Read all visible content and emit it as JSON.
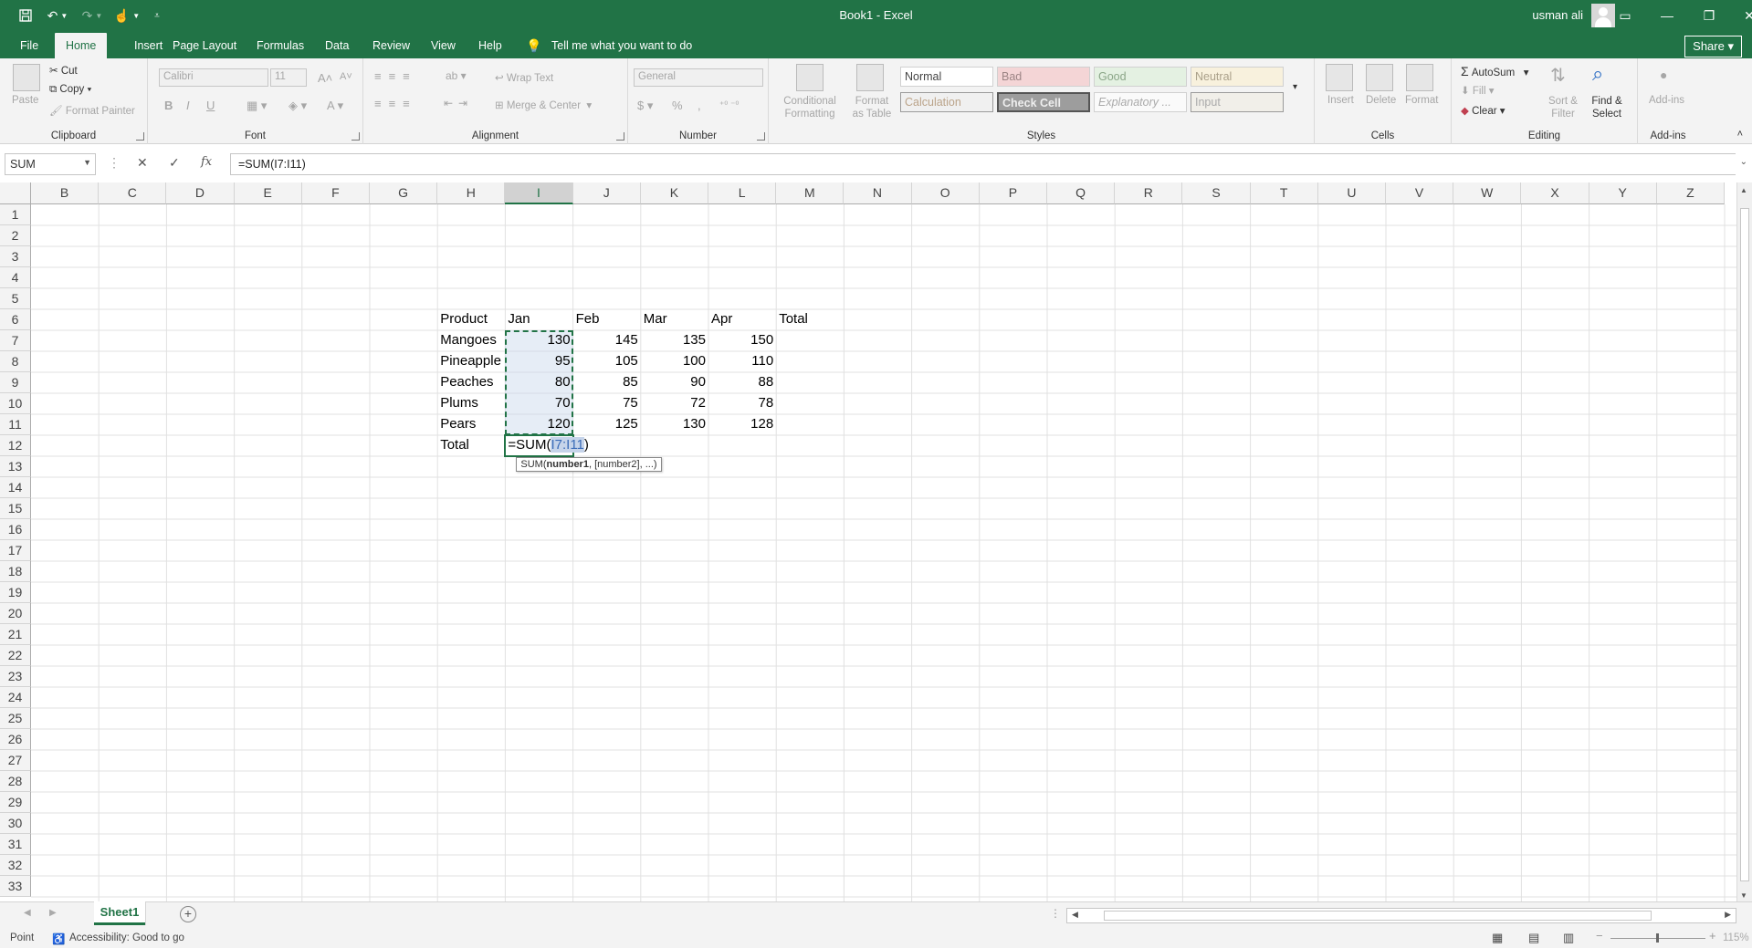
{
  "titlebar": {
    "title": "Book1  -  Excel",
    "user": "usman ali",
    "minimize": "—",
    "restore": "❐",
    "close": "✕",
    "ribbon_display": "▭"
  },
  "tabs": [
    "File",
    "Home",
    "Insert",
    "Page Layout",
    "Formulas",
    "Data",
    "Review",
    "View",
    "Help"
  ],
  "active_tab": "Home",
  "tell_me": "Tell me what you want to do",
  "share_label": "Share",
  "ribbon": {
    "clipboard": {
      "paste": "Paste",
      "cut": "Cut",
      "copy": "Copy",
      "format_painter": "Format Painter",
      "label": "Clipboard"
    },
    "font": {
      "font_name": "Calibri",
      "font_size": "11",
      "bold": "B",
      "italic": "I",
      "underline": "U",
      "label": "Font"
    },
    "alignment": {
      "wrap_text": "Wrap Text",
      "merge_center": "Merge & Center",
      "label": "Alignment"
    },
    "number": {
      "format": "General",
      "currency": "$",
      "percent": "%",
      "comma": ",",
      "label": "Number"
    },
    "styles": {
      "conditional_formatting": "Conditional Formatting",
      "format_as_table": "Format as Table",
      "cells": [
        "Normal",
        "Bad",
        "Good",
        "Neutral",
        "Calculation",
        "Check Cell",
        "Explanatory ...",
        "Input"
      ],
      "label": "Styles"
    },
    "cells": {
      "insert": "Insert",
      "delete": "Delete",
      "format": "Format",
      "label": "Cells"
    },
    "editing": {
      "autosum": "AutoSum",
      "fill": "Fill",
      "clear": "Clear",
      "sort_filter": "Sort & Filter",
      "find_select": "Find & Select",
      "label": "Editing"
    },
    "addins": {
      "addins": "Add-ins",
      "label": "Add-ins"
    }
  },
  "formula_bar": {
    "name_box": "SUM",
    "cancel": "✕",
    "enter": "✓",
    "fx": "fx",
    "formula": "=SUM(I7:I11)"
  },
  "columns": [
    "B",
    "C",
    "D",
    "E",
    "F",
    "G",
    "H",
    "I",
    "J",
    "K",
    "L",
    "M",
    "N",
    "O",
    "P",
    "Q",
    "R",
    "S",
    "T",
    "U",
    "V",
    "W",
    "X",
    "Y",
    "Z"
  ],
  "selected_column": "I",
  "rows": [
    "1",
    "2",
    "3",
    "4",
    "5",
    "6",
    "7",
    "8",
    "9",
    "10",
    "11",
    "12",
    "13",
    "14",
    "15",
    "16",
    "17",
    "18",
    "19",
    "20",
    "21",
    "22",
    "23",
    "24",
    "25",
    "26",
    "27",
    "28",
    "29",
    "30",
    "31",
    "32",
    "33"
  ],
  "table": {
    "headers": [
      "Product",
      "Jan",
      "Feb",
      "Mar",
      "Apr",
      "Total"
    ],
    "rows": [
      {
        "product": "Mangoes",
        "values": [
          "130",
          "145",
          "135",
          "150"
        ]
      },
      {
        "product": "Pineapple",
        "values": [
          "95",
          "105",
          "100",
          "110"
        ]
      },
      {
        "product": "Peaches",
        "values": [
          "80",
          "85",
          "90",
          "88"
        ]
      },
      {
        "product": "Plums",
        "values": [
          "70",
          "75",
          "72",
          "78"
        ]
      },
      {
        "product": "Pears",
        "values": [
          "120",
          "125",
          "130",
          "128"
        ]
      }
    ],
    "total_label": "Total",
    "editing_formula_prefix": "=SUM(",
    "editing_formula_ref": "I7:I11",
    "editing_formula_suffix": ")",
    "tooltip_prefix": "SUM(",
    "tooltip_bold": "number1",
    "tooltip_rest": ", [number2], ...)"
  },
  "sheet_tab": "Sheet1",
  "add_sheet": "+",
  "status": {
    "mode": "Point",
    "accessibility": "Accessibility: Good to go",
    "zoom": "115%"
  }
}
